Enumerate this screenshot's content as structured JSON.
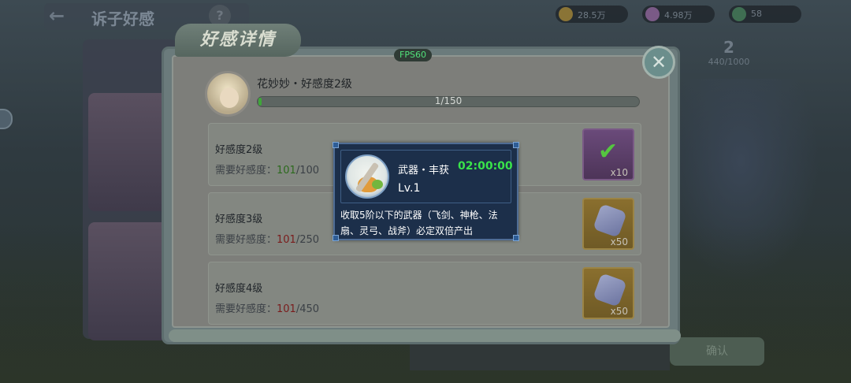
{
  "background": {
    "screen_title": "诉子好感",
    "confirm_label": "确认",
    "badge_number": "2",
    "badge_progress": "440/1000",
    "resources": [
      {
        "icon": "gold-coin-icon",
        "value": "28.5万",
        "color": "#a08440"
      },
      {
        "icon": "gem-icon",
        "value": "4.98万",
        "color": "#8f6a9a"
      },
      {
        "icon": "jade-icon",
        "value": "58",
        "color": "#4f8a64"
      }
    ]
  },
  "fps": "FPS60",
  "panel": {
    "title": "好感详情",
    "close_icon": "close-icon",
    "hero": {
      "name": "花妙妙・好感度2级",
      "progress_text": "1/150",
      "progress": {
        "current": 1,
        "max": 150
      }
    },
    "levels": [
      {
        "title": "好感度2级",
        "need_label": "需要好感度：",
        "current": "101",
        "target": "/100",
        "met": true,
        "reward": {
          "icon": "check-icon",
          "count": "x10",
          "style": "purple"
        }
      },
      {
        "title": "好感度3级",
        "need_label": "需要好感度：",
        "current": "101",
        "target": "/250",
        "met": false,
        "reward": {
          "icon": "crystal-icon",
          "count": "x50",
          "style": "gold"
        }
      },
      {
        "title": "好感度4级",
        "need_label": "需要好感度：",
        "current": "101",
        "target": "/450",
        "met": false,
        "reward": {
          "icon": "crystal-icon",
          "count": "x50",
          "style": "gold"
        }
      }
    ]
  },
  "tooltip": {
    "name": "武器・丰获",
    "timer": "02:00:00",
    "level": "Lv.1",
    "description": "收取5阶以下的武器（飞剑、神枪、法扇、灵弓、战斧）必定双倍产出",
    "icon": "weapon-harvest-icon"
  }
}
